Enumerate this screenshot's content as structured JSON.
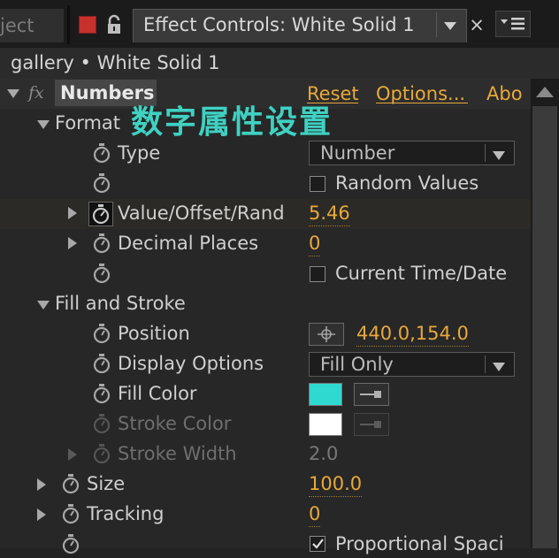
{
  "tabs": {
    "prev_tab_label": "ject",
    "active_tab_label": "Effect Controls: White Solid 1",
    "close_glyph": "×"
  },
  "breadcrumb": {
    "text": "gallery • White Solid 1"
  },
  "effect": {
    "name": "Numbers",
    "fx_label": "fx",
    "reset": "Reset",
    "options": "Options...",
    "about": "Abo"
  },
  "annotation": "数字属性设置",
  "rows": {
    "format": "Format",
    "type": "Type",
    "type_value": "Number",
    "random_values": "Random Values",
    "value_offset": "Value/Offset/Rand",
    "value_offset_value": "5.46",
    "decimal_places": "Decimal Places",
    "decimal_places_value": "0",
    "current_time": "Current Time/Date",
    "fill_and_stroke": "Fill and Stroke",
    "position": "Position",
    "position_value": "440.0,154.0",
    "display_options": "Display Options",
    "display_options_value": "Fill Only",
    "fill_color": "Fill Color",
    "stroke_color": "Stroke Color",
    "stroke_width": "Stroke Width",
    "stroke_width_value": "2.0",
    "size": "Size",
    "size_value": "100.0",
    "tracking": "Tracking",
    "tracking_value": "0",
    "proportional": "Proportional Spaci"
  },
  "colors": {
    "fill_color": "#2fd9cf",
    "stroke_color": "#ffffff",
    "value_gold": "#e8a93a",
    "annotation": "#3fd1c2"
  },
  "checkbox_state": {
    "random_values": false,
    "current_time": false,
    "proportional": true
  }
}
